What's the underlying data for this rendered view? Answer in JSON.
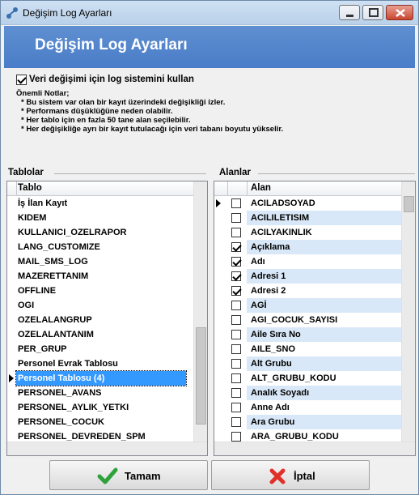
{
  "window": {
    "title": "Değişim Log Ayarları",
    "banner_title": "Değişim Log Ayarları"
  },
  "settings": {
    "enable_label": "Veri değişimi için log sistemini kullan",
    "enable_checked": true,
    "notes_title": "Önemli Notlar;",
    "notes": [
      "* Bu sistem var olan bir kayıt üzerindeki değişikliği izler.",
      "* Performans düşüklüğüne neden olabilir.",
      "* Her tablo için en fazla 50 tane alan seçilebilir.",
      "* Her değişikliğe ayrı bir kayıt tutulacağı için veri tabanı boyutu yükselir."
    ]
  },
  "tables_panel": {
    "label": "Tablolar",
    "column": "Tablo",
    "rows": [
      "İş İlan Kayıt",
      "KIDEM",
      "KULLANICI_OZELRAPOR",
      "LANG_CUSTOMIZE",
      "MAIL_SMS_LOG",
      "MAZERETTANIM",
      "OFFLINE",
      "OGI",
      "OZELALANGRUP",
      "OZELALANTANIM",
      "PER_GRUP",
      "Personel Evrak Tablosu",
      "Personel Tablosu (4)",
      "PERSONEL_AVANS",
      "PERSONEL_AYLIK_YETKI",
      "PERSONEL_COCUK",
      "PERSONEL_DEVREDEN_SPM"
    ],
    "selected_index": 12
  },
  "fields_panel": {
    "label": "Alanlar",
    "column": "Alan",
    "rows": [
      {
        "name": "ACILADSOYAD",
        "checked": false
      },
      {
        "name": "ACILILETISIM",
        "checked": false
      },
      {
        "name": "ACILYAKINLIK",
        "checked": false
      },
      {
        "name": "Açıklama",
        "checked": true
      },
      {
        "name": "Adı",
        "checked": true
      },
      {
        "name": "Adresi 1",
        "checked": true
      },
      {
        "name": "Adresi 2",
        "checked": true
      },
      {
        "name": "AGİ",
        "checked": false
      },
      {
        "name": "AGI_COCUK_SAYISI",
        "checked": false
      },
      {
        "name": "Aile Sıra No",
        "checked": false
      },
      {
        "name": "AILE_SNO",
        "checked": false
      },
      {
        "name": "Alt Grubu",
        "checked": false
      },
      {
        "name": "ALT_GRUBU_KODU",
        "checked": false
      },
      {
        "name": "Analık Soyadı",
        "checked": false
      },
      {
        "name": "Anne Adı",
        "checked": false
      },
      {
        "name": "Ara Grubu",
        "checked": false
      },
      {
        "name": "ARA_GRUBU_KODU",
        "checked": false
      }
    ],
    "current_index": 0
  },
  "buttons": {
    "ok_label": "Tamam",
    "cancel_label": "İptal"
  },
  "colors": {
    "banner": "#4a7dc8",
    "selection": "#3399ff",
    "alt_row": "#d9e8f8"
  }
}
